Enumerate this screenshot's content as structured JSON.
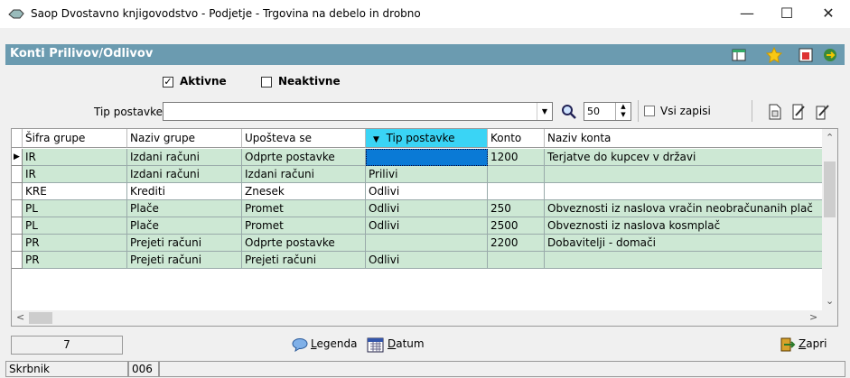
{
  "window": {
    "title": "Saop  Dvostavno knjigovodstvo - Podjetje - Trgovina na debelo in drobno",
    "minimize": "—",
    "maximize": "☐",
    "close": "✕"
  },
  "header": {
    "title": "Konti Prilivov/Odlivov"
  },
  "filters": {
    "active_label": "Aktivne",
    "active_checked": "✓",
    "inactive_label": "Neaktivne",
    "type_label": "Tip postavke",
    "type_value": "",
    "count_value": "50",
    "all_records_label": "Vsi zapisi"
  },
  "grid": {
    "columns": [
      "Šifra grupe",
      "Naziv grupe",
      "Upošteva se",
      "Tip postavke",
      "Konto",
      "Naziv konta"
    ],
    "sort_indicator": "▼",
    "rows": [
      [
        "IR",
        "Izdani računi",
        "Odprte postavke",
        "",
        "1200",
        "Terjatve do kupcev v      državi"
      ],
      [
        "IR",
        "Izdani računi",
        "Izdani računi",
        "Prilivi",
        "",
        ""
      ],
      [
        "KRE",
        "Krediti",
        "Znesek",
        "Odlivi",
        "",
        ""
      ],
      [
        "PL",
        "Plače",
        "Promet",
        "Odlivi",
        "250",
        "Obveznosti iz naslova vračin neobračunanih plač"
      ],
      [
        "PL",
        "Plače",
        "Promet",
        "Odlivi",
        "2500",
        "Obveznosti iz naslova kosmplač"
      ],
      [
        "PR",
        "Prejeti računi",
        "Odprte postavke",
        "",
        "2200",
        "Dobavitelji - domači"
      ],
      [
        "PR",
        "Prejeti računi",
        "Prejeti računi",
        "Odlivi",
        "",
        ""
      ]
    ]
  },
  "footer": {
    "record_count": "7",
    "legend_label": "Legenda",
    "legend_key": "L",
    "legend_rest": "egenda",
    "date_key": "D",
    "date_rest": "atum",
    "close_key": "Z",
    "close_rest": "apri"
  },
  "status": {
    "user_label": "Skrbnik",
    "user_code": "006"
  },
  "colors": {
    "header_bg": "#6b9bb0",
    "row_green": "#cde8d4",
    "row_white": "#ffffff",
    "sorted_col": "#3ad4f5",
    "selected_cell": "#0a7ad6"
  }
}
